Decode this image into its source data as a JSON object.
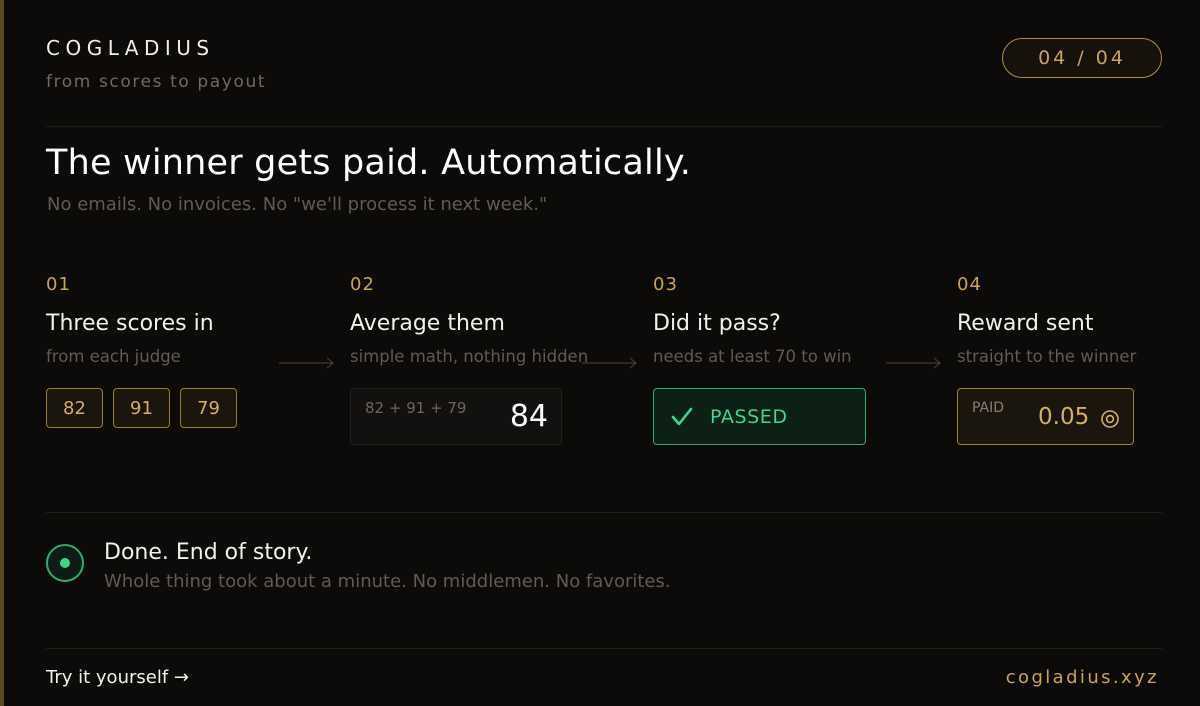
{
  "brand": {
    "name": "COGLADIUS",
    "tagline": "from scores to payout"
  },
  "pagination": "04 / 04",
  "headline": "The winner gets paid. Automatically.",
  "subhead": "No emails. No invoices. No \"we'll process it next week.\"",
  "steps": [
    {
      "number": "01",
      "title": "Three scores in",
      "desc": "from each judge",
      "scores": [
        "82",
        "91",
        "79"
      ]
    },
    {
      "number": "02",
      "title": "Average them",
      "desc": "simple math, nothing hidden",
      "formula": "82 + 91 + 79",
      "result": "84"
    },
    {
      "number": "03",
      "title": "Did it pass?",
      "desc": "needs at least 70 to win",
      "status": "PASSED"
    },
    {
      "number": "04",
      "title": "Reward sent",
      "desc": "straight to the winner",
      "paid_label": "PAID",
      "amount": "0.05",
      "coin_icon": "coin-icon"
    }
  ],
  "done": {
    "title": "Done. End of story.",
    "desc": "Whole thing took about a minute. No middlemen. No favorites."
  },
  "footer": {
    "cta": "Try it yourself →",
    "site": "cogladius.xyz"
  },
  "colors": {
    "accent_gold": "#c9a45a",
    "success_green": "#3ed88a",
    "background": "#0c0b0a"
  }
}
